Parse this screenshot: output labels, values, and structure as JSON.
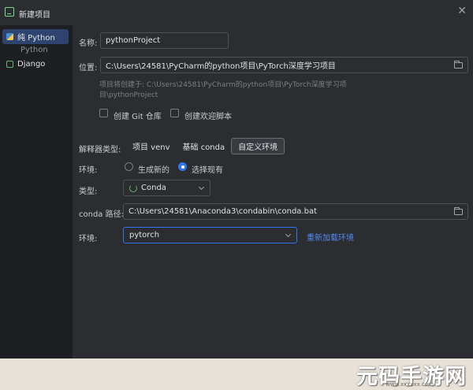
{
  "window": {
    "title": "新建项目"
  },
  "sidebar": {
    "items": [
      {
        "label": "纯 Python"
      },
      {
        "label": "Django"
      }
    ],
    "group_label": "Python"
  },
  "form": {
    "name_label": "名称:",
    "name_value": "pythonProject",
    "location_label": "位置:",
    "location_value": "C:\\Users\\24581\\PyCharm的python项目\\PyTorch深度学习项目",
    "hint_line1": "项目将创建于: C:\\Users\\24581\\PyCharm的python项目\\PyTorch深度学习项",
    "hint_line2": "目\\pythonProject",
    "git_label": "创建 Git 仓库",
    "welcome_label": "创建欢迎脚本",
    "interpreter_type_label": "解释器类型:",
    "interpreter_tabs": [
      "项目 venv",
      "基础 conda",
      "自定义环境"
    ],
    "env_label": "环境:",
    "env_option_new": "生成新的",
    "env_option_existing": "选择现有",
    "type_label": "类型:",
    "type_value": "Conda",
    "conda_path_label": "conda 路径:",
    "conda_path_value": "C:\\Users\\24581\\Anaconda3\\condabin\\conda.bat",
    "env2_label": "环境:",
    "env2_value": "pytorch",
    "reload_link": "重新加载环境"
  },
  "watermark": {
    "text": "元码手游网",
    "url": "www.xxxxxx.com"
  }
}
